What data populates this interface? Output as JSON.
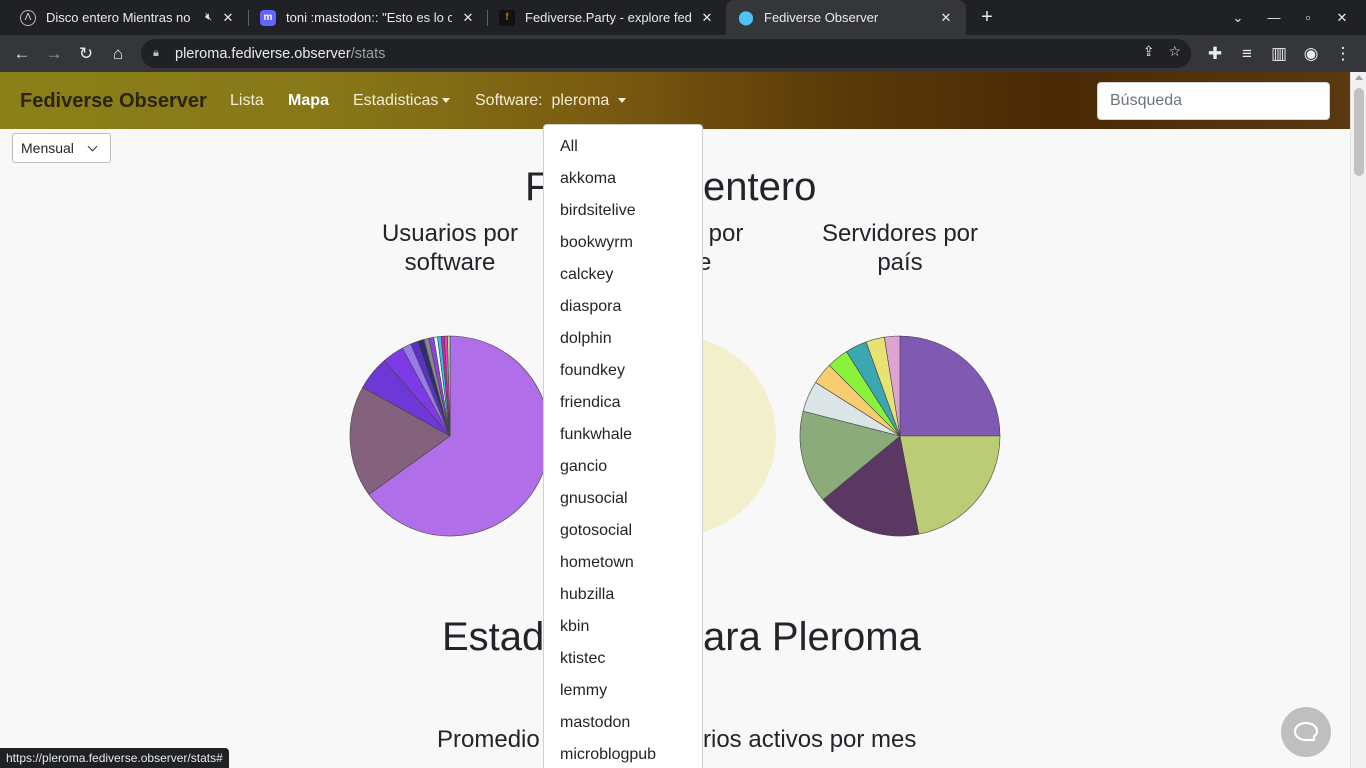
{
  "browser": {
    "tabs": [
      {
        "title": "Disco entero Mientras no",
        "muted": true
      },
      {
        "title": "toni :mastodon:: \"Esto es lo c",
        "muted": false
      },
      {
        "title": "Fediverse.Party - explore fede",
        "muted": false
      },
      {
        "title": "Fediverse Observer",
        "muted": false,
        "active": true
      }
    ],
    "url_host": "pleroma.fediverse.observer",
    "url_path": "/stats",
    "status_url": "https://pleroma.fediverse.observer/stats#"
  },
  "navbar": {
    "brand": "Fediverse Observer",
    "links": {
      "lista": "Lista",
      "mapa": "Mapa",
      "estadisticas": "Estadisticas",
      "software_label": "Software:",
      "software_value": "pleroma"
    },
    "search_placeholder": "Búsqueda"
  },
  "period_select": {
    "value": "Mensual"
  },
  "headings": {
    "section1_left": "F",
    "section1_right": "entero",
    "users_by_software_1": "Usuarios por",
    "users_by_software_2": "software",
    "hidden_title_1": "s por",
    "hidden_title_2": "re",
    "servers_by_country_1": "Servidores por",
    "servers_by_country_2": "país",
    "section2_left": "Estad",
    "section2_right": "ara Pleroma",
    "avg_left": "Promedio",
    "avg_right": "rios activos por mes"
  },
  "software_menu": [
    "All",
    "akkoma",
    "birdsitelive",
    "bookwyrm",
    "calckey",
    "diaspora",
    "dolphin",
    "foundkey",
    "friendica",
    "funkwhale",
    "gancio",
    "gnusocial",
    "gotosocial",
    "hometown",
    "hubzilla",
    "kbin",
    "ktistec",
    "lemmy",
    "mastodon",
    "microblogpub"
  ],
  "chart_data": [
    {
      "type": "pie",
      "title": "Usuarios por software",
      "values": [
        65,
        18,
        5.5,
        3.5,
        1.5,
        1.2,
        1.0,
        0.8,
        0.8,
        0.6,
        0.6,
        0.5,
        0.5,
        0.4
      ],
      "colors": [
        "#b06ee8",
        "#84627e",
        "#6d38d6",
        "#7d3ae6",
        "#9a7ae8",
        "#5a32c8",
        "#2e2e6e",
        "#888888",
        "#9040e0",
        "#e8f8ff",
        "#30c0e8",
        "#e020a0",
        "#f040c0",
        "#a8e8a0"
      ]
    },
    {
      "type": "pie",
      "title": "",
      "values": [
        100
      ],
      "colors": [
        "#f1efcc"
      ]
    },
    {
      "type": "pie",
      "title": "Servidores por país",
      "values": [
        25,
        22,
        17,
        15,
        5,
        3.5,
        3.5,
        3.5,
        3,
        2.5
      ],
      "colors": [
        "#8059b3",
        "#bacd76",
        "#5b3864",
        "#8bab7b",
        "#dbe4e6",
        "#f7cd6f",
        "#89f23d",
        "#3ba7b0",
        "#e6e372",
        "#dea2d3"
      ]
    }
  ]
}
